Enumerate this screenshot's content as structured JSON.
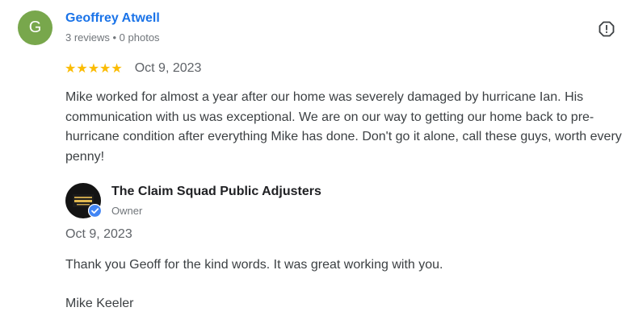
{
  "review": {
    "avatar_letter": "G",
    "avatar_color": "#78a74c",
    "reviewer_name": "Geoffrey Atwell",
    "reviewer_meta": "3 reviews • 0 photos",
    "rating": 5,
    "stars": "★★★★★",
    "date": "Oct 9, 2023",
    "text": "Mike worked for almost a year after our home was severely damaged by hurricane Ian. His communication with us was exceptional. We are on our way to getting our home back to pre-hurricane condition after everything Mike has done. Don't go it alone, call these guys, worth every penny!",
    "flag_icon": "flag-icon"
  },
  "reply": {
    "owner_name": "The Claim Squad Public Adjusters",
    "owner_role": "Owner",
    "date": "Oct 9, 2023",
    "line1": "Thank you Geoff for the kind words. It was great working with you.",
    "line2": "Mike Keeler",
    "badge_icon": "verified-check-icon"
  },
  "colors": {
    "link_blue": "#1a73e8",
    "star_yellow": "#fbbc04",
    "verified_blue": "#4285f4"
  }
}
